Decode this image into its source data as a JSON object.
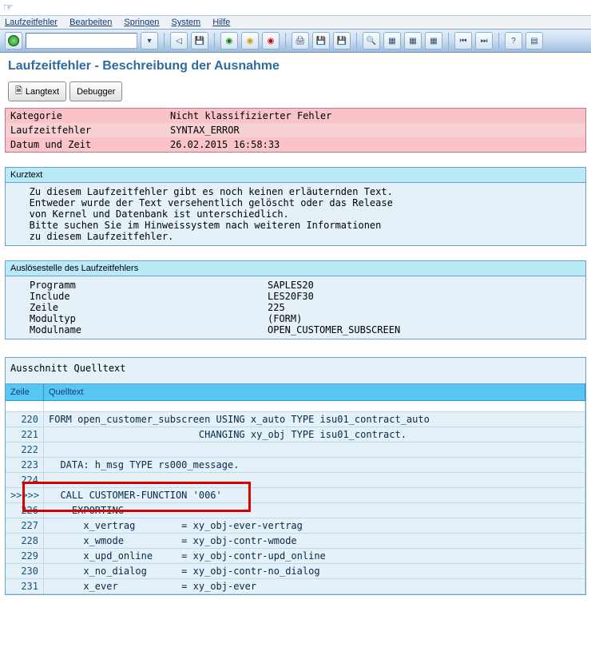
{
  "menu": {
    "items": [
      "Laufzeitfehler",
      "Bearbeiten",
      "Springen",
      "System",
      "Hilfe"
    ]
  },
  "title": "Laufzeitfehler - Beschreibung der Ausnahme",
  "buttons": {
    "langtext": "Langtext",
    "debugger": "Debugger"
  },
  "header": {
    "rows": [
      {
        "k": "Kategorie",
        "v": "Nicht klassifizierter Fehler"
      },
      {
        "k": "Laufzeitfehler",
        "v": "SYNTAX_ERROR"
      },
      {
        "k": "Datum und Zeit",
        "v": "26.02.2015 16:58:33"
      }
    ]
  },
  "kurztext": {
    "label": "Kurztext",
    "lines": [
      "   Zu diesem Laufzeitfehler gibt es noch keinen erläuternden Text.",
      "   Entweder wurde der Text versehentlich gelöscht oder das Release",
      "   von Kernel und Datenbank ist unterschiedlich.",
      "   Bitte suchen Sie im Hinweissystem nach weiteren Informationen",
      "   zu diesem Laufzeitfehler."
    ]
  },
  "ausloese": {
    "label": "Auslösestelle des Laufzeitfehlers",
    "rows": [
      {
        "k": "Programm",
        "v": "SAPLES20"
      },
      {
        "k": "Include",
        "v": "LES20F30"
      },
      {
        "k": "Zeile",
        "v": "225"
      },
      {
        "k": "Modultyp",
        "v": "(FORM)"
      },
      {
        "k": "Modulname",
        "v": "OPEN_CUSTOMER_SUBSCREEN"
      }
    ]
  },
  "source": {
    "label": "Ausschnitt Quelltext",
    "col_line": "Zeile",
    "col_src": "Quelltext",
    "rows": [
      {
        "no": "220",
        "txt": "FORM open_customer_subscreen USING x_auto TYPE isu01_contract_auto"
      },
      {
        "no": "221",
        "txt": "                          CHANGING xy_obj TYPE isu01_contract."
      },
      {
        "no": "222",
        "txt": ""
      },
      {
        "no": "223",
        "txt": "  DATA: h_msg TYPE rs000_message."
      },
      {
        "no": "224",
        "txt": ""
      },
      {
        "no": ">>>>>",
        "txt": "  CALL CUSTOMER-FUNCTION '006'"
      },
      {
        "no": "226",
        "txt": "    EXPORTING"
      },
      {
        "no": "227",
        "txt": "      x_vertrag        = xy_obj-ever-vertrag"
      },
      {
        "no": "228",
        "txt": "      x_wmode          = xy_obj-contr-wmode"
      },
      {
        "no": "229",
        "txt": "      x_upd_online     = xy_obj-contr-upd_online"
      },
      {
        "no": "230",
        "txt": "      x_no_dialog      = xy_obj-contr-no_dialog"
      },
      {
        "no": "231",
        "txt": "      x_ever           = xy_obj-ever"
      }
    ]
  }
}
